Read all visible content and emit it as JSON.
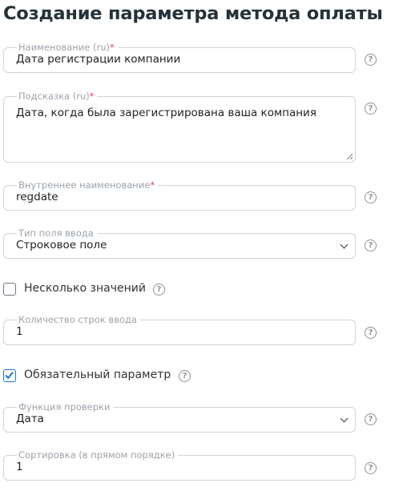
{
  "page": {
    "title": "Создание параметра метода оплаты"
  },
  "form": {
    "name": {
      "label": "Наименование (ru)",
      "required_mark": "*",
      "value": "Дата регистрации компании",
      "help_icon": "question-circle-icon"
    },
    "hint": {
      "label": "Подсказка (ru)",
      "required_mark": "*",
      "value": "Дата, когда была зарегистрирована ваша компания",
      "help_icon": "question-circle-icon"
    },
    "internal_name": {
      "label": "Внутреннее наименование",
      "required_mark": "*",
      "value": "regdate",
      "help_icon": "question-circle-icon"
    },
    "input_type": {
      "label": "Тип поля ввода",
      "selected": "Строковое поле",
      "help_icon": "question-circle-icon"
    },
    "multiple_values": {
      "label": "Несколько значений",
      "checked": false,
      "help_icon": "question-circle-icon"
    },
    "input_rows": {
      "label": "Количество строк ввода",
      "value": "1",
      "help_icon": "question-circle-icon"
    },
    "required_param": {
      "label": "Обязательный параметр",
      "checked": true,
      "help_icon": "question-circle-icon"
    },
    "validation_function": {
      "label": "Функция проверки",
      "selected": "Дата",
      "help_icon": "question-circle-icon"
    },
    "sort_order": {
      "label": "Сортировка (в прямом порядке)",
      "value": "1",
      "help_icon": "question-circle-icon"
    },
    "help_glyph": "?"
  },
  "colors": {
    "accent": "#1976d2",
    "required": "#e0405a",
    "border": "#cfd4d9",
    "label": "#9aa3ab"
  }
}
